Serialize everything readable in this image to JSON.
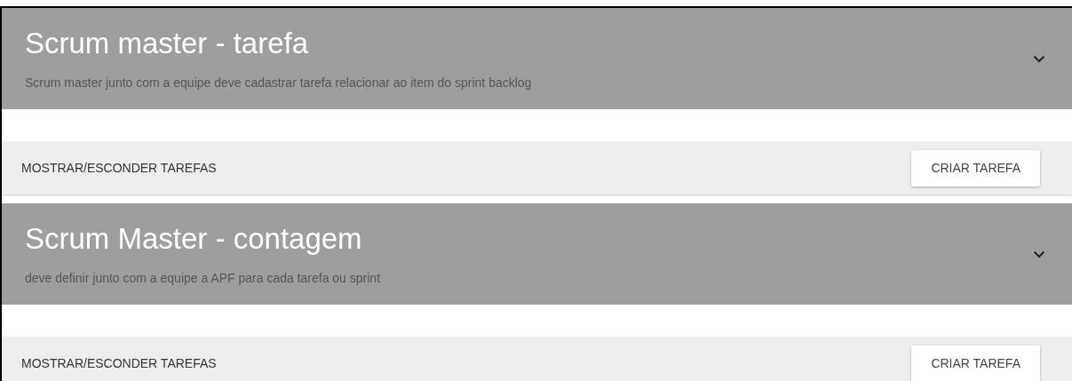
{
  "panels": [
    {
      "title": "Scrum master - tarefa",
      "description": "Scrum master junto com a equipe deve cadastrar tarefa relacionar ao item do sprint backlog",
      "expanded": false,
      "toggle_label": "MOSTRAR/ESCONDER TAREFAS",
      "button": "CRIAR TAREFA"
    },
    {
      "title": "Scrum Master - contagem",
      "description": "deve definir junto com a equipe a APF para cada tarefa ou sprint",
      "expanded": false,
      "toggle_label": "MOSTRAR/ESCONDER TAREFAS",
      "button": "CRIAR TAREFA"
    }
  ]
}
